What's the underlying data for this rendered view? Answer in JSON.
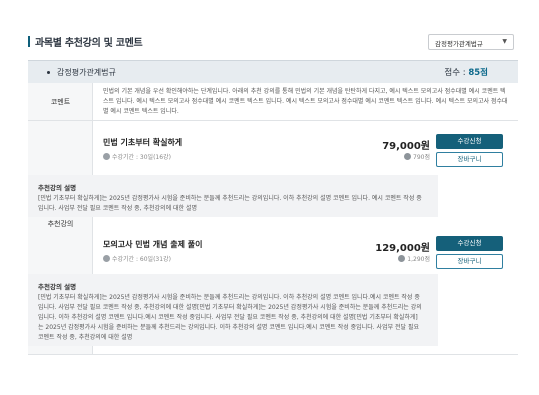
{
  "header": {
    "title": "과목별 추천강의 및 코멘트",
    "select_value": "감정평가관계법규"
  },
  "subject": {
    "name": "감정평가관계법규",
    "score_label": "점수 : ",
    "score_value": "85점"
  },
  "comment": {
    "label": "코멘트",
    "text": "민법의 기본 개념을 우선 확인해야하는 단계입니다. 아래의 추천 강의를 통해 민법의 기본 개념을 탄탄하게 다지고, 예시 텍스트 모의고사 점수대별 예시 코멘트 텍스트 입니다. 예시 텍스트 모의고사 점수대별 예시 코멘트 텍스트 입니다. 예시 텍스트 모의고사 점수대별 예시 코멘트 텍스트 입니다. 예시 텍스트 모의고사 점수대별 예시 코멘트 텍스트 입니다."
  },
  "recommend": {
    "label": "추천강의",
    "courses": [
      {
        "title": "민법 기초부터 확실하게",
        "period": "수강기간 : 30일(16강)",
        "price": "79,000원",
        "points": "790점",
        "enroll_label": "수강신청",
        "cart_label": "장바구니",
        "desc_title": "추천강의 설명",
        "desc_text": "[민법 기초부터 확실하게]는 2025년 감정평가사 시험을 준비하는 분들께 추천드리는 강의입니다. 이하 추천강의 설명 코멘트 입니다. 예시 코멘트 작성 중입니다. 사업부 전달 필요 코멘트 작성 중, 추천강의에 대한 설명"
      },
      {
        "title": "모의고사 민법 개념 출제 풀이",
        "period": "수강기간 : 60일(31강)",
        "price": "129,000원",
        "points": "1,290점",
        "enroll_label": "수강신청",
        "cart_label": "장바구니",
        "desc_title": "추천강의 설명",
        "desc_text": "[민법 기초부터 확실하게]는 2025년 감정평가사 시험을 준비하는 분들께 추천드리는 강의입니다. 이하 추천강의 설명 코멘트 입니다.예시 코멘트 작성 중입니다. 사업부 전달 필요 코멘트 작성 중, 추천강의에 대한 설명[민법 기초부터 확실하게]는 2025년 감정평가사 시험을 준비하는 분들께 추천드리는 강의입니다. 이하 추천강의 설명 코멘트 입니다.예시 코멘트 작성 중입니다. 사업부 전달 필요 코멘트 작성 중, 추천강의에 대한 설명[민법 기초부터 확실하게]는 2025년 감정평가사 시험을 준비하는 분들께 추천드리는 강의입니다. 이하 추천강의 설명 코멘트 입니다.예시 코멘트 작성 중입니다. 사업부 전달 필요 코멘트 작성 중, 추천강의에 대한 설명"
      }
    ]
  }
}
